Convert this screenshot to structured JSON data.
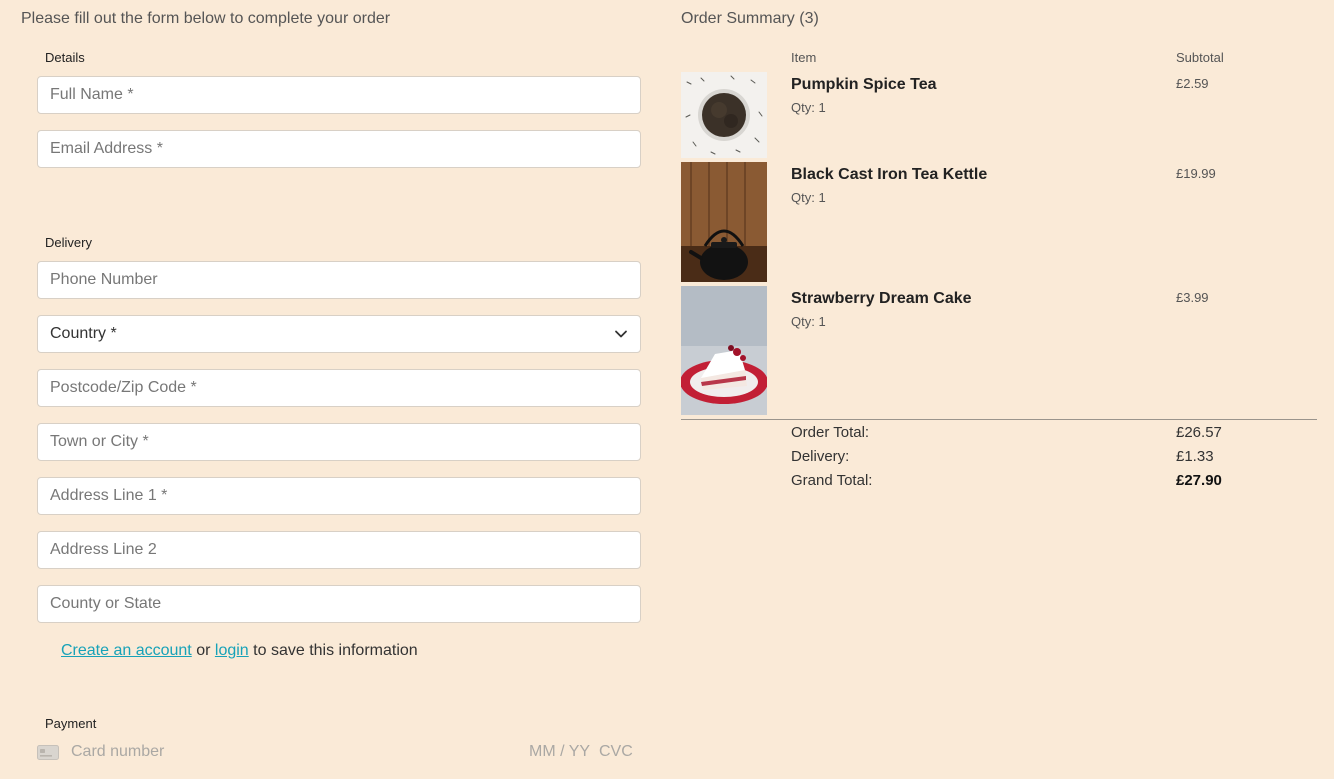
{
  "intro": "Please fill out the form below to complete your order",
  "form": {
    "details_label": "Details",
    "full_name_placeholder": "Full Name *",
    "email_placeholder": "Email Address *",
    "delivery_label": "Delivery",
    "phone_placeholder": "Phone Number",
    "country_placeholder": "Country *",
    "postcode_placeholder": "Postcode/Zip Code *",
    "town_placeholder": "Town or City *",
    "address1_placeholder": "Address Line 1 *",
    "address2_placeholder": "Address Line 2",
    "county_placeholder": "County or State",
    "account": {
      "create_link": "Create an account",
      "or": "or",
      "login_link": "login",
      "suffix": "to save this information"
    },
    "payment_label": "Payment",
    "card_number_placeholder": "Card number",
    "expiry_placeholder": "MM / YY",
    "cvc_placeholder": "CVC"
  },
  "summary": {
    "title": "Order Summary (3)",
    "col_item": "Item",
    "col_subtotal": "Subtotal",
    "items": [
      {
        "name": "Pumpkin Spice Tea",
        "qty": "Qty: 1",
        "price": "£2.59"
      },
      {
        "name": "Black Cast Iron Tea Kettle",
        "qty": "Qty: 1",
        "price": "£19.99"
      },
      {
        "name": "Strawberry Dream Cake",
        "qty": "Qty: 1",
        "price": "£3.99"
      }
    ],
    "order_total_label": "Order Total:",
    "order_total": "£26.57",
    "delivery_label": "Delivery:",
    "delivery": "£1.33",
    "grand_total_label": "Grand Total:",
    "grand_total": "£27.90"
  },
  "icons": {
    "country_dropdown": "chevron-down-icon",
    "card": "credit-card-icon"
  },
  "colors": {
    "background": "#faead7",
    "link": "#17a2b8"
  }
}
